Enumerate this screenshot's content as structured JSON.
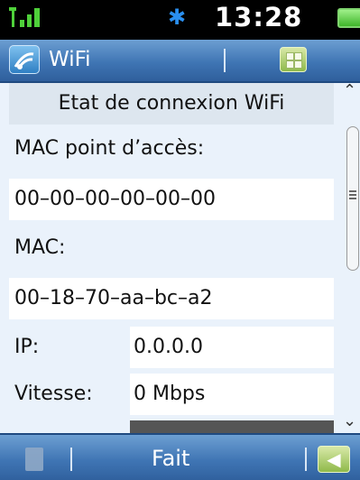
{
  "status_bar": {
    "time": "13:28",
    "signal_icon": "signal-bars-icon",
    "bluetooth_icon": "bluetooth-icon",
    "battery_icon": "battery-icon"
  },
  "title_bar": {
    "title": "WiFi",
    "app_icon": "wifi-app-icon",
    "menu_icon": "grid-menu-icon"
  },
  "rows": {
    "header": "Etat de connexion WiFi",
    "ap_mac_label": "MAC point d’accès:",
    "ap_mac_value": "00–00–00–00–00–00",
    "mac_label": "MAC:",
    "mac_value": "00–18–70–aa–bc–a2",
    "ip_label": "IP:",
    "ip_value": "0.0.0.0",
    "speed_label": "Vitesse:",
    "speed_value": "0 Mbps"
  },
  "bottom_bar": {
    "done_label": "Fait",
    "left_icon": "options-icon",
    "back_icon": "back-arrow-icon"
  },
  "colors": {
    "title_bar": "#3f75b4",
    "content_bg": "#eaf2fb",
    "accent_green": "#8fb94a"
  }
}
